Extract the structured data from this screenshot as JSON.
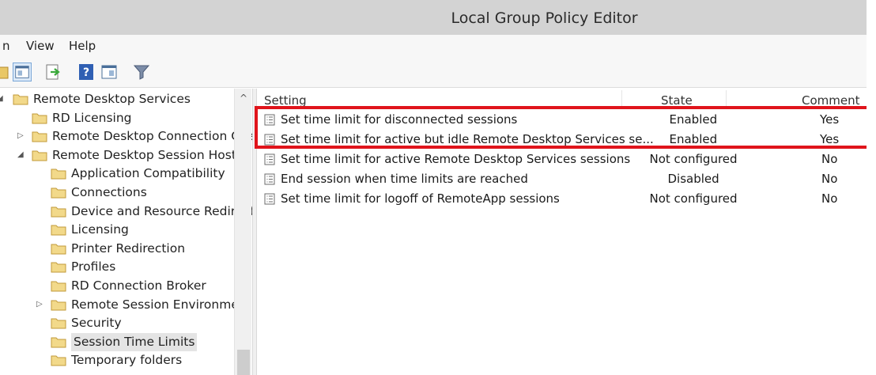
{
  "window": {
    "title": "Local Group Policy Editor"
  },
  "menu": {
    "items": [
      "n",
      "View",
      "Help"
    ]
  },
  "toolbar": {
    "buttons": [
      "folder-icon",
      "console-tree-icon",
      "export-icon",
      "help-icon",
      "properties-icon",
      "filter-icon"
    ]
  },
  "tree": {
    "items": [
      {
        "label": "Remote Desktop Services",
        "expander": "◢",
        "indent": 0
      },
      {
        "label": "RD Licensing",
        "expander": "",
        "indent": 1
      },
      {
        "label": "Remote Desktop Connection Clie",
        "expander": "▷",
        "indent": 1
      },
      {
        "label": "Remote Desktop Session Host",
        "expander": "◢",
        "indent": 1
      },
      {
        "label": "Application Compatibility",
        "expander": "",
        "indent": 2
      },
      {
        "label": "Connections",
        "expander": "",
        "indent": 2
      },
      {
        "label": "Device and Resource Redirect",
        "expander": "",
        "indent": 2
      },
      {
        "label": "Licensing",
        "expander": "",
        "indent": 2
      },
      {
        "label": "Printer Redirection",
        "expander": "",
        "indent": 2
      },
      {
        "label": "Profiles",
        "expander": "",
        "indent": 2
      },
      {
        "label": "RD Connection Broker",
        "expander": "",
        "indent": 2
      },
      {
        "label": "Remote Session Environment",
        "expander": "▷",
        "indent": 2
      },
      {
        "label": "Security",
        "expander": "",
        "indent": 2
      },
      {
        "label": "Session Time Limits",
        "expander": "",
        "indent": 2,
        "selected": true
      },
      {
        "label": "Temporary folders",
        "expander": "",
        "indent": 2
      }
    ]
  },
  "list": {
    "headers": {
      "setting": "Setting",
      "state": "State",
      "comment": "Comment"
    },
    "rows": [
      {
        "setting": "Set time limit for disconnected sessions",
        "state": "Enabled",
        "comment": "Yes"
      },
      {
        "setting": "Set time limit for active but idle Remote Desktop Services se...",
        "state": "Enabled",
        "comment": "Yes"
      },
      {
        "setting": "Set time limit for active Remote Desktop Services sessions",
        "state": "Not configured",
        "comment": "No"
      },
      {
        "setting": "End session when time limits are reached",
        "state": "Disabled",
        "comment": "No"
      },
      {
        "setting": "Set time limit for logoff of RemoteApp sessions",
        "state": "Not configured",
        "comment": "No"
      }
    ]
  },
  "colors": {
    "highlight": "#e0141b",
    "titlebar": "#d3d3d3",
    "folder": "#f2d98a"
  }
}
